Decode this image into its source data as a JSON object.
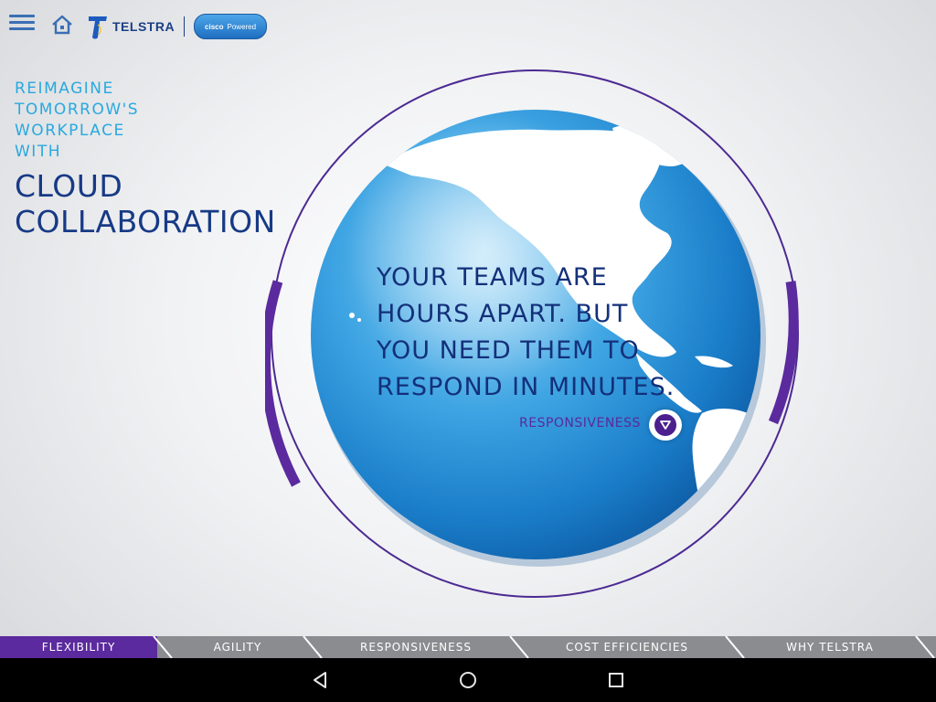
{
  "header": {
    "brand_name": "TELSTRA",
    "partner_badge": {
      "logo_word": "cisco",
      "label": "Powered"
    }
  },
  "headline": {
    "kicker_lines": [
      "REIMAGINE",
      "TOMORROW'S",
      "WORKPLACE",
      "WITH"
    ],
    "title_lines": [
      "CLOUD",
      "COLLABORATION"
    ]
  },
  "hero": {
    "message_lines": [
      "YOUR TEAMS ARE",
      "HOURS APART. BUT",
      "YOU NEED THEM TO",
      "RESPOND IN MINUTES."
    ],
    "topic_label": "RESPONSIVENESS",
    "topic_button_icon": "chevron-down-triangle-icon"
  },
  "tabs": [
    {
      "label": "FLEXIBILITY",
      "active": true
    },
    {
      "label": "AGILITY",
      "active": false
    },
    {
      "label": "RESPONSIVENESS",
      "active": false
    },
    {
      "label": "COST EFFICIENCIES",
      "active": false
    },
    {
      "label": "WHY TELSTRA",
      "active": false
    }
  ],
  "system_nav": {
    "back_icon": "back-triangle-icon",
    "home_icon": "home-circle-icon",
    "recents_icon": "recents-square-icon"
  },
  "colors": {
    "accent_purple": "#5b2a9e",
    "brand_navy": "#173a86",
    "kicker_blue": "#28a9e0",
    "globe_blue": "#1e8ed6",
    "tab_gray": "#8a8c8f"
  }
}
